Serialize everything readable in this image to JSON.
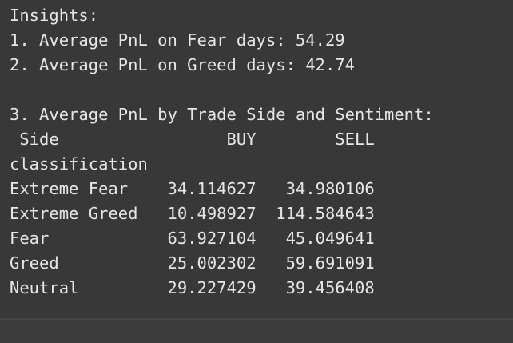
{
  "output": {
    "heading": "Insights:",
    "fear_avg": "1. Average PnL on Fear days: 54.29",
    "greed_avg": "2. Average PnL on Greed days: 42.74",
    "blank": "",
    "side_heading": "3. Average PnL by Trade Side and Sentiment:",
    "table": {
      "header": " Side                 BUY        SELL",
      "index_name": "classification",
      "rows": [
        "Extreme Fear    34.114627   34.980106",
        "Extreme Greed   10.498927  114.584643",
        "Fear            63.927104   45.049641",
        "Greed           25.002302   59.691091",
        "Neutral         29.227429   39.456408"
      ]
    }
  }
}
